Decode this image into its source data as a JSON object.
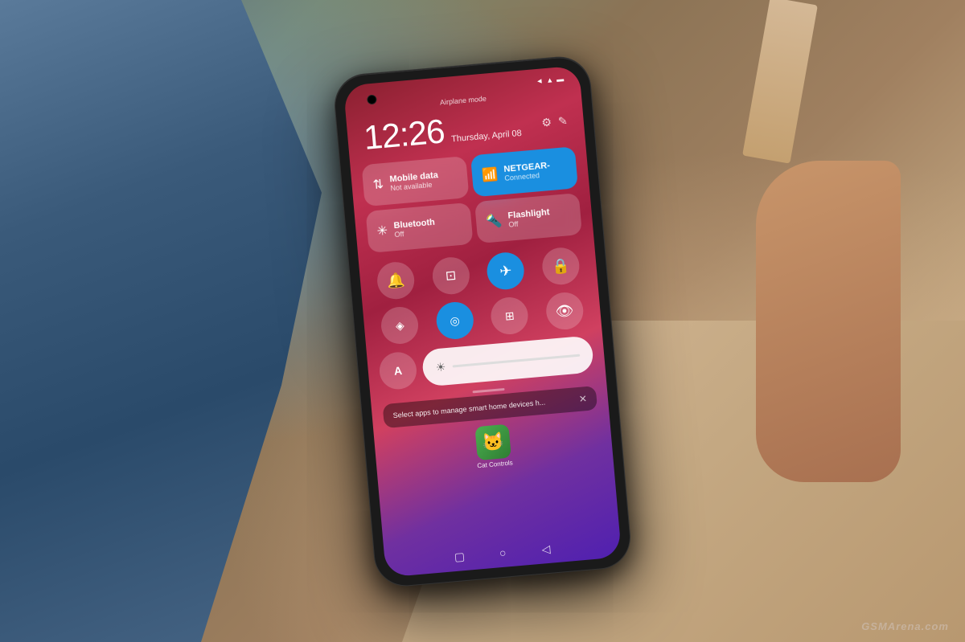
{
  "background": {
    "color_left": "#4a6278",
    "color_right": "#c4a882"
  },
  "phone": {
    "status_bar": {
      "airplane_mode": "Airplane mode",
      "signal_icons": "◄ ▲",
      "wifi_icon": "wifi",
      "battery_icon": "battery"
    },
    "time": {
      "clock": "12:26",
      "date": "Thursday, April 08"
    },
    "tiles": [
      {
        "id": "mobile-data",
        "icon": "⇅",
        "label": "Mobile data",
        "sublabel": "Not available",
        "active": false
      },
      {
        "id": "wifi",
        "icon": "wifi",
        "label": "NETGEAR-",
        "sublabel": "Connected",
        "active": true
      },
      {
        "id": "bluetooth",
        "icon": "bluetooth",
        "label": "Bluetooth",
        "sublabel": "Off",
        "active": false
      },
      {
        "id": "flashlight",
        "icon": "flashlight",
        "label": "Flashlight",
        "sublabel": "Off",
        "active": false
      }
    ],
    "toggles_row1": [
      {
        "id": "bell",
        "icon": "🔔",
        "active": false,
        "label": "bell-icon"
      },
      {
        "id": "screenshot",
        "icon": "⊡",
        "active": false,
        "label": "screenshot-icon"
      },
      {
        "id": "airplane",
        "icon": "✈",
        "active": true,
        "label": "airplane-icon"
      },
      {
        "id": "lock",
        "icon": "🔒",
        "active": false,
        "label": "lock-icon"
      }
    ],
    "toggles_row2": [
      {
        "id": "location",
        "icon": "◈",
        "active": false,
        "label": "location-icon"
      },
      {
        "id": "focus",
        "icon": "◎",
        "active": true,
        "label": "focus-icon"
      },
      {
        "id": "scan",
        "icon": "⊞",
        "active": false,
        "label": "scan-icon"
      },
      {
        "id": "eye",
        "icon": "👁",
        "active": false,
        "label": "eye-icon"
      }
    ],
    "brightness": {
      "icon": "☀",
      "label": "brightness-slider"
    },
    "text_label": "A",
    "divider": true,
    "smart_home": {
      "text": "Select apps to manage smart home devices h...",
      "close_icon": "✕"
    },
    "app": {
      "icon": "🐱",
      "label": "Cat Controls"
    },
    "nav_bar": {
      "square_btn": "▢",
      "home_btn": "○",
      "back_btn": "◁"
    }
  },
  "watermark": {
    "text": "GSMArena.com"
  }
}
